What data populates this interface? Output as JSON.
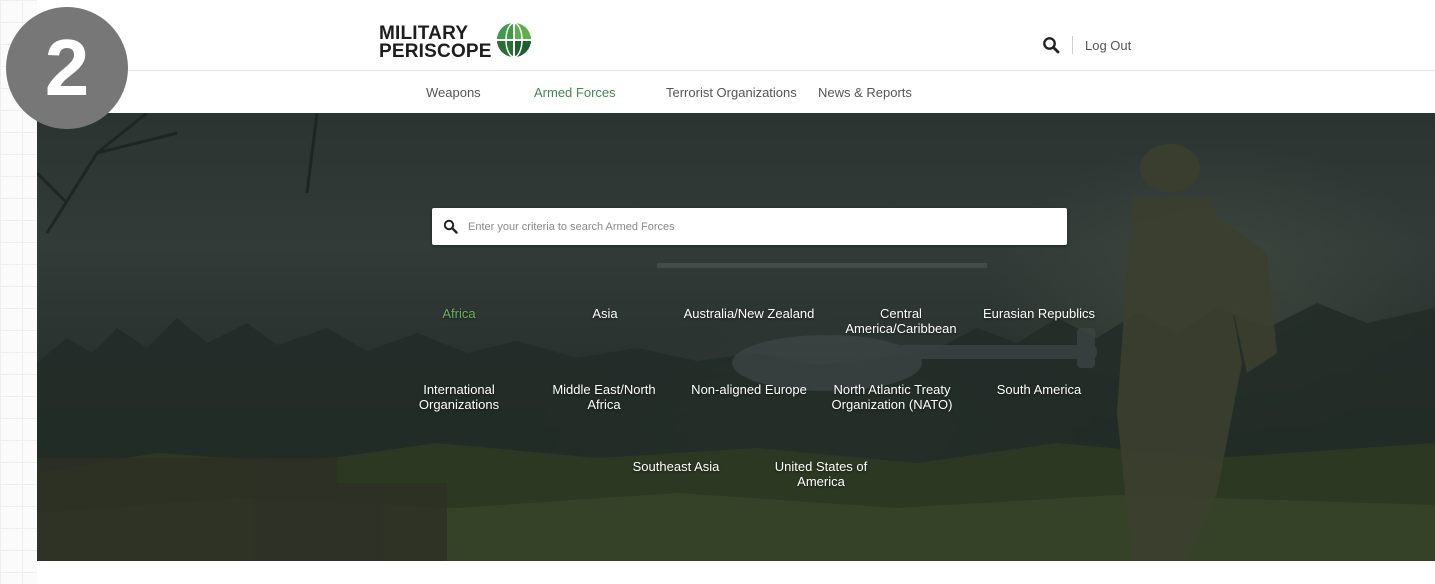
{
  "step_badge": "2",
  "logo": {
    "line1": "MILITARY",
    "line2": "PERISCOPE"
  },
  "header": {
    "logout_label": "Log Out"
  },
  "nav": [
    {
      "label": "Weapons"
    },
    {
      "label": "Armed Forces"
    },
    {
      "label": "Terrorist Organizations"
    },
    {
      "label": "News & Reports"
    }
  ],
  "search": {
    "placeholder": "Enter your criteria to search Armed Forces",
    "value": ""
  },
  "regions": [
    {
      "label": "Africa"
    },
    {
      "label": "Asia"
    },
    {
      "label": "Australia/New Zealand"
    },
    {
      "label": "Central America/Caribbean"
    },
    {
      "label": "Eurasian Republics"
    },
    {
      "label": "International Organizations"
    },
    {
      "label": "Middle East/North Africa"
    },
    {
      "label": "Non-aligned Europe"
    },
    {
      "label": "North Atlantic Treaty Organization (NATO)"
    },
    {
      "label": "South America"
    },
    {
      "label": "Southeast Asia"
    },
    {
      "label": "United States of America"
    }
  ],
  "colors": {
    "accent": "#6fae5e",
    "nav_active": "#3f8a4d",
    "badge": "#777777"
  }
}
